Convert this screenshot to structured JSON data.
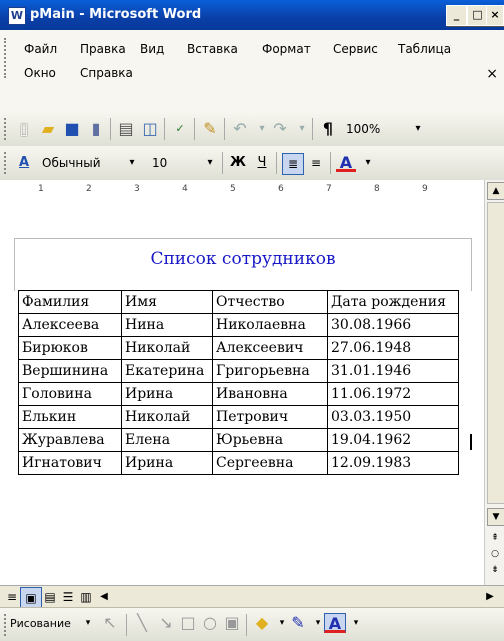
{
  "window": {
    "title": "pMain - Microsoft Word",
    "icon": "word-icon"
  },
  "menu": {
    "items": [
      "Файл",
      "Правка",
      "Вид",
      "Вставка",
      "Формат",
      "Сервис",
      "Таблица",
      "Окно",
      "Справка"
    ],
    "close_glyph": "×"
  },
  "standard_toolbar": {
    "zoom": "100%",
    "paragraph_mark": "¶"
  },
  "format_toolbar": {
    "style": "Обычный",
    "size": "10",
    "bold": "Ж",
    "underline": "Ч",
    "font_color": "A",
    "style_icon_glyph": "A"
  },
  "ruler": {
    "labels": [
      "1",
      "2",
      "3",
      "4",
      "5",
      "6",
      "7",
      "8",
      "9"
    ]
  },
  "document": {
    "title": "Список сотрудников",
    "table": {
      "headers": [
        "Фамилия",
        "Имя",
        "Отчество",
        "Дата рождения"
      ],
      "rows": [
        [
          "Алексеева",
          "Нина",
          "Николаевна",
          "30.08.1966"
        ],
        [
          "Бирюков",
          "Николай",
          "Алексеевич",
          "27.06.1948"
        ],
        [
          "Вершинина",
          "Екатерина",
          "Григорьевна",
          "31.01.1946"
        ],
        [
          "Головина",
          "Ирина",
          "Ивановна",
          "11.06.1972"
        ],
        [
          "Елькин",
          "Николай",
          "Петрович",
          "03.03.1950"
        ],
        [
          "Журавлева",
          "Елена",
          "Юрьевна",
          "19.04.1962"
        ],
        [
          "Игнатович",
          "Ирина",
          "Сергеевна",
          "12.09.1983"
        ]
      ]
    }
  },
  "drawing_toolbar": {
    "label": "Рисование"
  },
  "colors": {
    "title_blue": "#1818c8",
    "titlebar": "#0a4cc0"
  }
}
